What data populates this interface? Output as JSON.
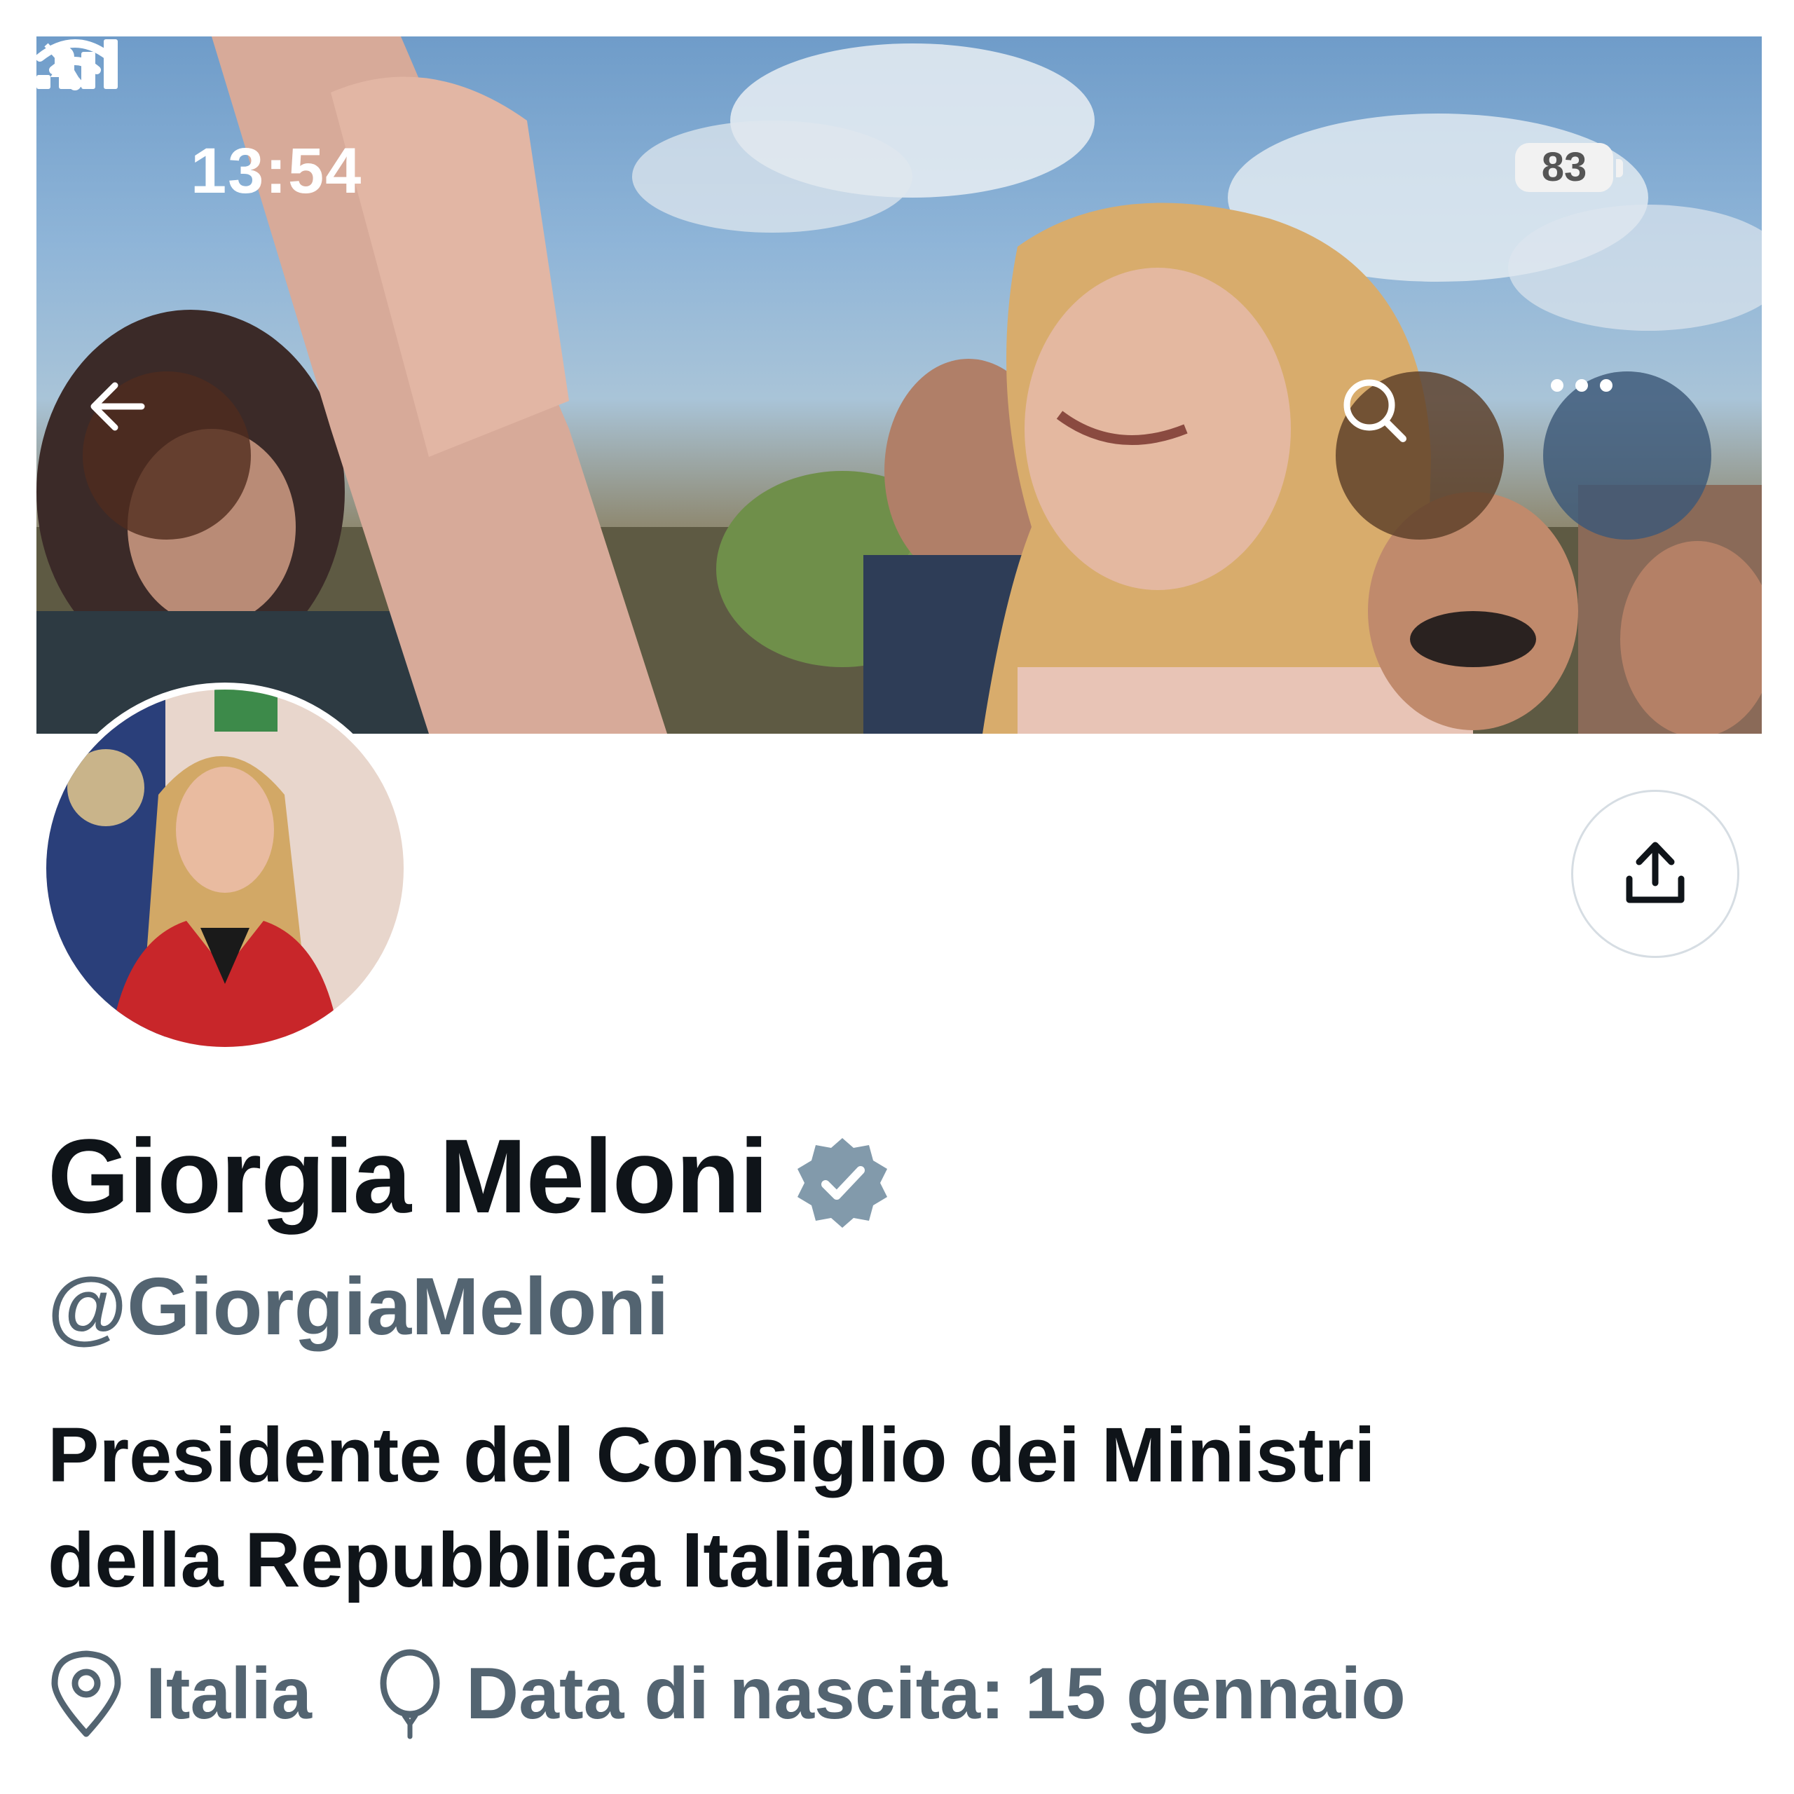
{
  "status_bar": {
    "time": "13:54",
    "battery": "83",
    "icons": [
      "bell-slash-icon",
      "signal-icon",
      "wifi-icon",
      "battery-icon"
    ]
  },
  "header": {
    "back_icon": "arrow-left-icon",
    "search_icon": "search-icon",
    "more_icon": "more-horizontal-icon"
  },
  "profile": {
    "name": "Giorgia Meloni",
    "verified": true,
    "verified_color": "#829aab",
    "handle": "@GiorgiaMeloni",
    "bio_line1": "Presidente del Consiglio dei Ministri",
    "bio_line2": "della Repubblica Italiana",
    "location": "Italia",
    "birthday": "Data di nascita: 15 gennaio"
  },
  "actions": {
    "share_icon": "share-icon"
  },
  "colors": {
    "text_primary": "#0f1419",
    "text_secondary": "#536471",
    "border": "#d6dde3"
  }
}
